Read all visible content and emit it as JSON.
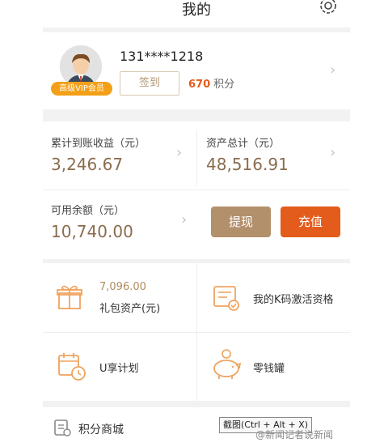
{
  "header": {
    "title": "我的"
  },
  "profile": {
    "phone": "131****1218",
    "vip_badge": "高级VIP会员",
    "sign_in_label": "签到",
    "points_value": "670",
    "points_unit": "积分"
  },
  "stats": {
    "cumulative_label": "累计到账收益（元）",
    "cumulative_value": "3,246.67",
    "total_assets_label": "资产总计（元）",
    "total_assets_value": "48,516.91",
    "available_label": "可用余额（元）",
    "available_value": "10,740.00",
    "withdraw_label": "提现",
    "recharge_label": "充值"
  },
  "grid": {
    "gift_value": "7,096.00",
    "gift_label": "礼包资产(元)",
    "kcode_label": "我的K码激活资格",
    "u_plan_label": "U享计划",
    "piggy_label": "零钱罐"
  },
  "mall": {
    "label": "积分商城"
  },
  "overlay": {
    "tooltip": "截图(Ctrl + Alt + X)",
    "watermark": "@新闻记者说新闻"
  },
  "colors": {
    "accent_orange": "#e35c1c",
    "brown_button": "#b3906c",
    "gold_text": "#8a6d4f",
    "vip_badge": "#f3a018"
  }
}
